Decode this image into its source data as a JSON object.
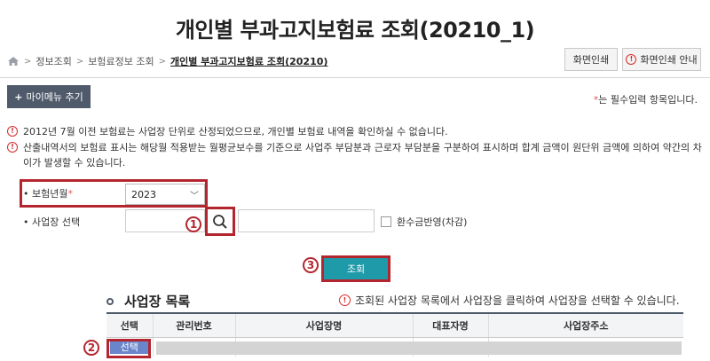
{
  "page": {
    "title": "개인별 부과고지보험료 조회(20210_1)"
  },
  "breadcrumb": {
    "items": [
      "정보조회",
      "보험료정보 조회",
      "개인별 부과고지보험료 조회(20210)"
    ]
  },
  "header_buttons": {
    "print": "화면인쇄",
    "print_guide": "화면인쇄 안내"
  },
  "mymenu": {
    "label": "마이메뉴 추기",
    "plus": "+"
  },
  "required_note": {
    "star": "*",
    "text": "는 필수입력 항목입니다."
  },
  "notices": [
    "2012년 7월 이전 보험료는 사업장 단위로 산정되었으므로, 개인별 보험료 내역을 확인하실 수 없습니다.",
    "산출내역서의 보험료 표시는 해당월 적용받는 월평균보수를 기준으로 사업주 부담분과 근로자 부담분을 구분하여 표시하며 합계 금액이 원단위 금액에 의하여 약간의 차이가 발생할 수 있습니다."
  ],
  "form": {
    "year_label": "• 보험년월",
    "year_star": "*",
    "year_value": "2023",
    "year_chevron": "﹀",
    "work_label": "• 사업장 선택",
    "refund_label": "환수금반영(차감)"
  },
  "callouts": {
    "one": "1",
    "two": "2",
    "three": "3"
  },
  "submit": {
    "label": "조회"
  },
  "list_section": {
    "title": "사업장 목록",
    "notice": "조회된 사업장 목록에서 사업장을 클릭하여 사업장을 선택할 수 있습니다."
  },
  "table": {
    "headers": [
      "선택",
      "관리번호",
      "사업장명",
      "대표자명",
      "사업장주소"
    ],
    "row_select_label": "선택"
  },
  "colors": {
    "accent_red": "#b3262f",
    "submit_teal": "#1f9aa8",
    "select_blue": "#6a85c9",
    "dark_slate": "#4f5a6a"
  }
}
